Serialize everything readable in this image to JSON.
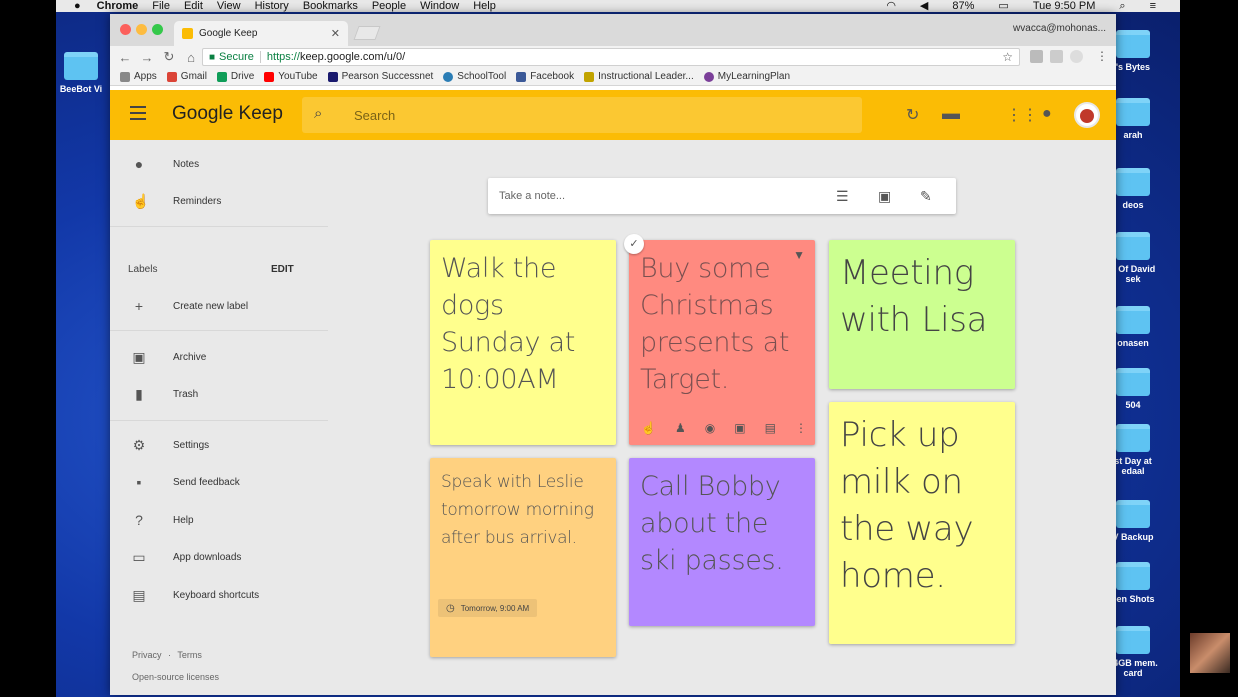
{
  "menubar": {
    "app_name": "Chrome",
    "items": [
      "File",
      "Edit",
      "View",
      "History",
      "Bookmarks",
      "People",
      "Window",
      "Help"
    ],
    "battery": "87%",
    "clock": "Tue 9:50 PM"
  },
  "desktop_icons": [
    {
      "label": "BeeBot Vi"
    },
    {
      "label": "'s Bytes"
    },
    {
      "label": "arah"
    },
    {
      "label": "deos"
    },
    {
      "label": "s Of David sek"
    },
    {
      "label": "onasen"
    },
    {
      "label": "504"
    },
    {
      "label": "st Day at edaal"
    },
    {
      "label": "V Backup"
    },
    {
      "label": "een Shots"
    },
    {
      "label": "64GB mem. card"
    }
  ],
  "browser": {
    "tab_title": "Google Keep",
    "profile": "wvacca@mohonas...",
    "secure_label": "Secure",
    "url_scheme": "https://",
    "url_rest": "keep.google.com/u/0/",
    "bookmarks": [
      {
        "label": "Apps",
        "color": "#888888"
      },
      {
        "label": "Gmail",
        "color": "#db4437"
      },
      {
        "label": "Drive",
        "color": "#0f9d58"
      },
      {
        "label": "YouTube",
        "color": "#ff0000"
      },
      {
        "label": "Pearson Successnet",
        "color": "#1a1a6e"
      },
      {
        "label": "SchoolTool",
        "color": "#2a7db5"
      },
      {
        "label": "Facebook",
        "color": "#3b5998"
      },
      {
        "label": "Instructional Leader...",
        "color": "#c2a400"
      },
      {
        "label": "MyLearningPlan",
        "color": "#7b3f99"
      }
    ]
  },
  "keep": {
    "app_name": "Google Keep",
    "search_placeholder": "Search",
    "accent_color": "#fbbc05",
    "sidebar": {
      "items": [
        {
          "label": "Notes",
          "icon": "bulb-icon"
        },
        {
          "label": "Reminders",
          "icon": "reminder-hand-icon"
        },
        {
          "label": "Create new label",
          "icon": "plus-icon"
        },
        {
          "label": "Archive",
          "icon": "archive-icon"
        },
        {
          "label": "Trash",
          "icon": "trash-icon"
        },
        {
          "label": "Settings",
          "icon": "gear-icon"
        },
        {
          "label": "Send feedback",
          "icon": "feedback-icon"
        },
        {
          "label": "Help",
          "icon": "help-icon"
        },
        {
          "label": "App downloads",
          "icon": "devices-icon"
        },
        {
          "label": "Keyboard shortcuts",
          "icon": "keyboard-icon"
        }
      ],
      "labels_header": "Labels",
      "labels_edit": "EDIT",
      "privacy": "Privacy",
      "terms": "Terms",
      "dot": "·",
      "open_source": "Open-source licenses"
    },
    "take_note_placeholder": "Take a note...",
    "notes": [
      {
        "text": "Walk the dogs Sunday at 10:00AM",
        "color": "#ffff8d"
      },
      {
        "text": "Buy some Christmas presents at Target.",
        "color": "#ff8a80"
      },
      {
        "text": "Meeting with Lisa",
        "color": "#ccff90"
      },
      {
        "text": "Speak with Leslie tomorrow morning after bus arrival.",
        "color": "#ffd180",
        "reminder": "Tomorrow, 9:00 AM"
      },
      {
        "text": "Call Bobby about the ski passes.",
        "color": "#b388ff"
      },
      {
        "text": "Pick up milk on the way home.",
        "color": "#ffff8d"
      }
    ]
  }
}
